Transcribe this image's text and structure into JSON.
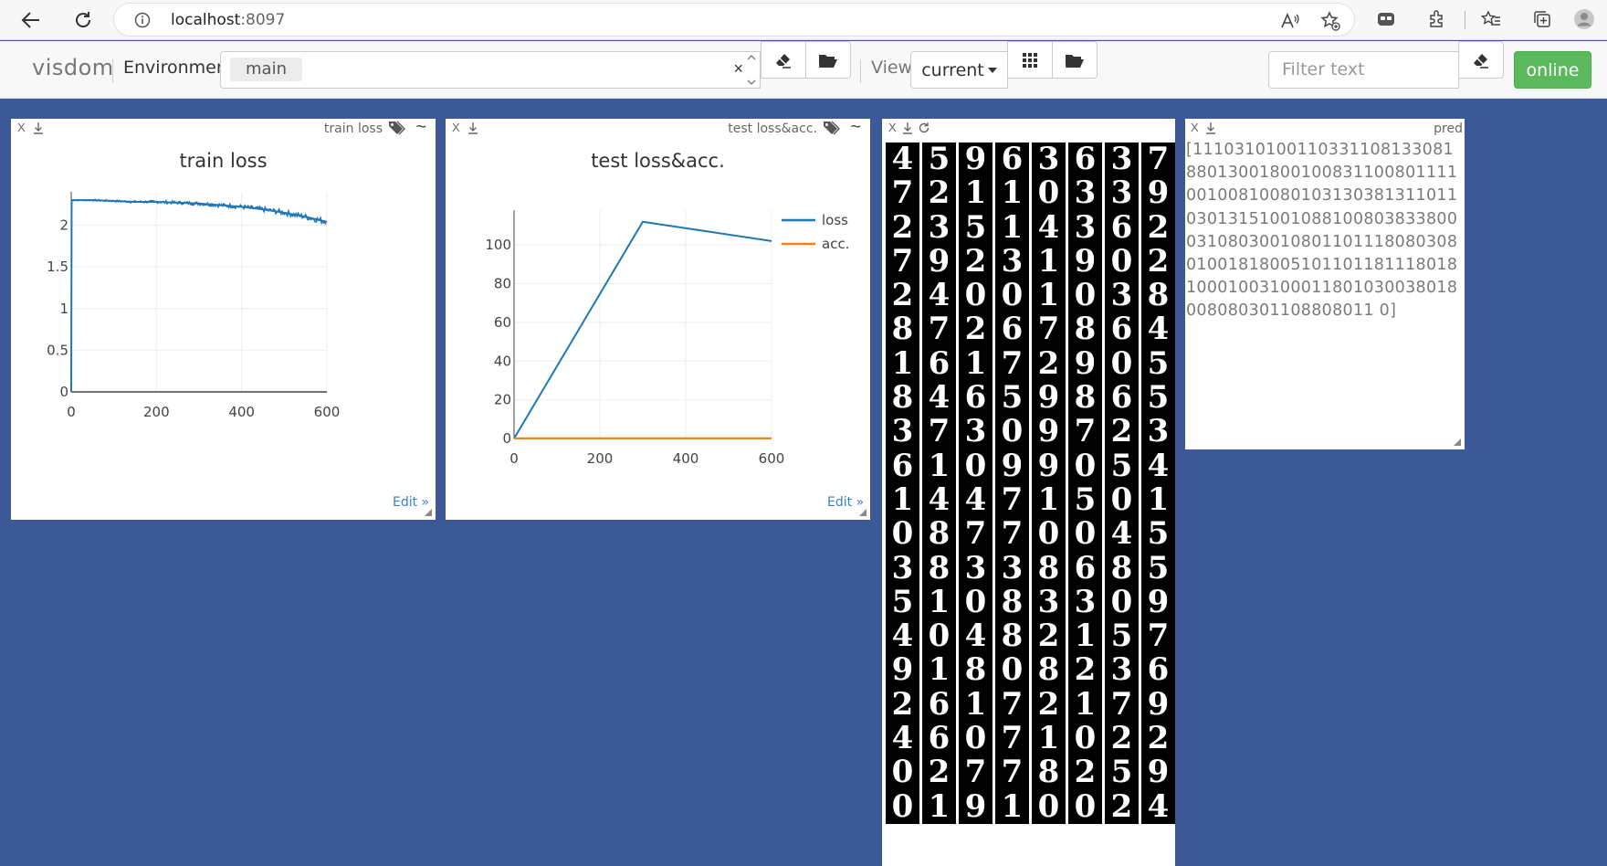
{
  "browser": {
    "url_host": "localhost",
    "url_port": ":8097"
  },
  "navbar": {
    "brand": "visdom",
    "environment_label": "Environment",
    "environment_value": "main",
    "clear_symbol": "×",
    "view_label": "View",
    "view_value": "current",
    "filter_placeholder": "Filter text",
    "online_label": "online"
  },
  "panes": {
    "train_loss": {
      "close": "X",
      "name": "train loss",
      "edit": "Edit »"
    },
    "test_loss": {
      "close": "X",
      "name": "test loss&acc.",
      "edit": "Edit »"
    },
    "images": {
      "close": "X",
      "rows": [
        "45963637",
        "72110339",
        "23514362",
        "79231902",
        "24001038",
        "87267864",
        "16172905",
        "84659865",
        "37309723",
        "61099054",
        "14471501",
        "08770045",
        "38338685",
        "51083309",
        "40482157",
        "91808236",
        "26172179",
        "46071022",
        "02778259",
        "01910024"
      ]
    },
    "pred": {
      "close": "X",
      "name": "pred",
      "text": "[1110310100110331108133081880130018001008311008011110010081008010313038131101103013151001088100803833800031080300108011011180803080100181800510110118111801810001003100011801030038018008080301108808011 0]"
    }
  },
  "chart_data": [
    {
      "type": "line",
      "title": "train loss",
      "xlim": [
        0,
        600
      ],
      "ylim": [
        0,
        2.4
      ],
      "x_ticks": [
        "0",
        "200",
        "400",
        "600"
      ],
      "y_ticks": [
        "0",
        "0.5",
        "1",
        "1.5",
        "2"
      ],
      "grid": true,
      "series": [
        {
          "color": "#1f77b4",
          "x": [
            0,
            1,
            50,
            100,
            150,
            200,
            250,
            300,
            350,
            400,
            450,
            500,
            550,
            600
          ],
          "y": [
            0,
            2.3,
            2.3,
            2.29,
            2.28,
            2.28,
            2.27,
            2.26,
            2.24,
            2.22,
            2.19,
            2.15,
            2.1,
            2.04
          ]
        }
      ]
    },
    {
      "type": "line",
      "title": "test loss&acc.",
      "xlim": [
        0,
        600
      ],
      "ylim": [
        0,
        118
      ],
      "x_ticks": [
        "0",
        "200",
        "400",
        "600"
      ],
      "y_ticks": [
        "0",
        "20",
        "40",
        "60",
        "80",
        "100"
      ],
      "grid": true,
      "legend": "top-right",
      "series": [
        {
          "name": "loss",
          "color": "#1f77b4",
          "x": [
            0,
            300,
            600
          ],
          "y": [
            0,
            112,
            102
          ]
        },
        {
          "name": "acc.",
          "color": "#ff7f0e",
          "x": [
            0,
            300,
            600
          ],
          "y": [
            0.1,
            0.1,
            0.1
          ]
        }
      ]
    }
  ]
}
